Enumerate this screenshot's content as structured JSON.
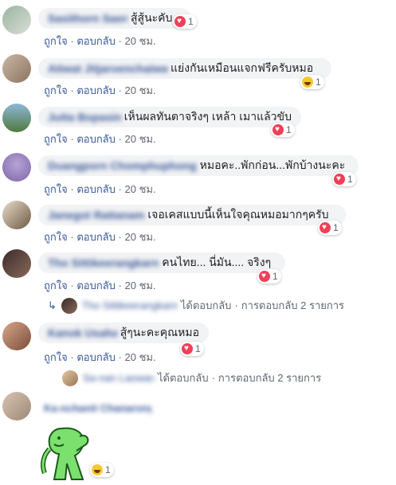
{
  "comments": [
    {
      "name": "Sasithorn Saengjai",
      "text": "สู้สู้นะคับ",
      "reactions": {
        "type": "love",
        "count": "1"
      },
      "like": "ถูกใจ",
      "reply": "ตอบกลับ",
      "time": "20 ชม."
    },
    {
      "name": "Atiwat Jitjaroenchaiwan",
      "text": "แย่งกันเหมือนแจกฟรีครับหมอ",
      "reactions": {
        "type": "haha",
        "count": "1"
      },
      "like": "ถูกใจ",
      "reply": "ตอบกลับ",
      "time": "20 ชม."
    },
    {
      "name": "Jutta Bopasin",
      "text": "เห็นผลทันตาจริงๆ เหล้า เมาแล้วขับ",
      "reactions": {
        "type": "love",
        "count": "1"
      },
      "like": "ถูกใจ",
      "reply": "ตอบกลับ",
      "time": "20 ชม."
    },
    {
      "name": "Duangporn Chomphuphong",
      "text": "หมอคะ..พักก่อน...พักบ้างนะคะ",
      "reactions": {
        "type": "love",
        "count": "1"
      },
      "like": "ถูกใจ",
      "reply": "ตอบกลับ",
      "time": "20 ชม."
    },
    {
      "name": "Janegot Rattanam",
      "text": "เจอเคสแบบนี้เห็นใจคุณหมอมากๆครับ",
      "reactions": {
        "type": "love",
        "count": "1"
      },
      "like": "ถูกใจ",
      "reply": "ตอบกลับ",
      "time": "20 ชม."
    },
    {
      "name": "Tho Sittikeerangkarn",
      "text": "คนไทย... นี่มัน.... จริงๆ",
      "reactions": {
        "type": "love",
        "count": "1"
      },
      "like": "ถูกใจ",
      "reply": "ตอบกลับ",
      "time": "20 ชม.",
      "replies": {
        "name": "Tho Sittikeerangkarn",
        "replied": "ได้ตอบกลับ",
        "count_text": "การตอบกลับ 2 รายการ"
      }
    },
    {
      "name": "Kanok Usaha",
      "text": "สู้ๆนะคะคุณหมอ",
      "reactions": {
        "type": "love",
        "count": "1"
      },
      "like": "ถูกใจ",
      "reply": "ตอบกลับ",
      "time": "20 ชม.",
      "replies": {
        "name": "Sa-nan Laowarat",
        "replied": "ได้ตอบกลับ",
        "count_text": "การตอบกลับ 2 รายการ"
      }
    },
    {
      "name": "Ka-nchanit Chanarong",
      "text": "",
      "sticker": "green-character-sticker",
      "reactions": {
        "type": "sad",
        "count": "1"
      }
    }
  ],
  "sep": "·"
}
